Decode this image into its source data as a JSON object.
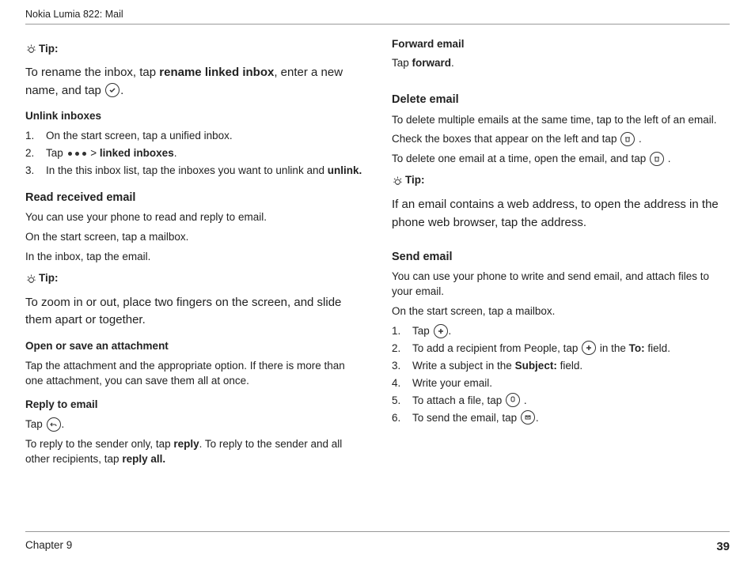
{
  "header": "Nokia Lumia 822: Mail",
  "footer": {
    "chapter": "Chapter 9",
    "page": "39"
  },
  "left": {
    "tip1": {
      "label": "Tip:",
      "text_pre": "To rename the inbox, tap ",
      "bold1": "rename linked inbox",
      "text_mid": ", enter a new name, and tap ",
      "text_end": "."
    },
    "unlink": {
      "title": "Unlink inboxes",
      "items": {
        "i1": "On the start screen, tap a unified inbox.",
        "i2_pre": "Tap ",
        "i2_mid": " > ",
        "i2_bold": "linked inboxes",
        "i2_end": ".",
        "i3_pre": "In the this inbox list, tap the inboxes you want to unlink and ",
        "i3_bold": "unlink."
      }
    },
    "read": {
      "title": "Read received email",
      "p1": "You can use your phone to read and reply to email.",
      "p2": "On the start screen, tap a mailbox.",
      "p3": "In the inbox, tap the email."
    },
    "tip2": {
      "label": "Tip:",
      "text": "To zoom in or out, place two fingers on the screen, and slide them apart or together."
    },
    "attach": {
      "title": "Open or save an attachment",
      "p1": "Tap the attachment and the appropriate option. If there is more than one attachment, you can save them all at once."
    },
    "reply": {
      "title": "Reply to email",
      "p1_pre": "Tap ",
      "p1_end": ".",
      "p2_pre": "To reply to the sender only, tap ",
      "p2_bold1": "reply",
      "p2_mid": ". To reply to the sender and all other recipients, tap ",
      "p2_bold2": "reply all."
    }
  },
  "right": {
    "forward": {
      "title": "Forward email",
      "p1_pre": "Tap ",
      "p1_bold": "forward",
      "p1_end": "."
    },
    "delete": {
      "title": "Delete email",
      "p1": "To delete multiple emails at the same time, tap to the left of an email.",
      "p2_pre": "Check the boxes that appear on the left and tap ",
      "p2_end": " .",
      "p3_pre": "To delete one email at a time, open the email, and tap ",
      "p3_end": " ."
    },
    "tip3": {
      "label": "Tip:",
      "text": "If an email contains a web address, to open the address in the phone web browser, tap the address."
    },
    "send": {
      "title": "Send email",
      "p1": "You can use your phone to write and send email, and attach files to your email.",
      "p2": "On the start screen, tap a mailbox.",
      "items": {
        "i1_pre": "Tap ",
        "i1_end": ".",
        "i2_pre": "To add a recipient from People, tap ",
        "i2_mid": " in the ",
        "i2_bold": "To:",
        "i2_end": " field.",
        "i3_pre": "Write a subject in the ",
        "i3_bold": "Subject:",
        "i3_end": " field.",
        "i4": "Write your email.",
        "i5_pre": "To attach a file, tap ",
        "i5_end": " .",
        "i6_pre": "To send the email, tap ",
        "i6_end": "."
      }
    }
  }
}
